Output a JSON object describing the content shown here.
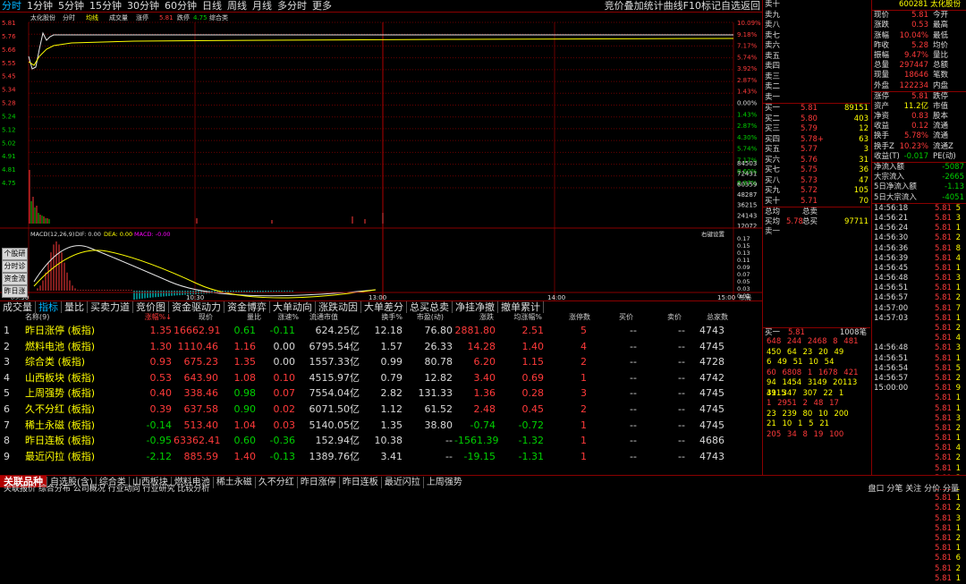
{
  "topbar": {
    "timeframes": [
      "分时",
      "1分钟",
      "5分钟",
      "15分钟",
      "30分钟",
      "60分钟",
      "日线",
      "周线",
      "月线",
      "多分时",
      "更多"
    ],
    "right_text": "竞价叠加统计曲线F10标记自选返回"
  },
  "chart_header": {
    "name": "太化股份",
    "labels": [
      "分时",
      "均线",
      "成交量",
      "涨停"
    ],
    "price_label": "5.81",
    "drop_label": "跌停",
    "drop_value": "4.75",
    "mode": "综合类"
  },
  "price_axis": {
    "left": [
      "5.81",
      "5.76",
      "5.66",
      "5.55",
      "5.45",
      "5.34",
      "5.28",
      "5.24",
      "5.12",
      "5.02",
      "4.91",
      "4.81",
      "4.75"
    ],
    "right": [
      "10.09%",
      "9.18%",
      "7.17%",
      "5.74%",
      "3.92%",
      "2.87%",
      "1.43%",
      "0.00%",
      "1.43%",
      "2.87%",
      "4.30%",
      "5.74%",
      "7.17%",
      "8.60%",
      "9.87%"
    ]
  },
  "volume_axis": [
    "84503",
    "72431",
    "60359",
    "48287",
    "36215",
    "24143",
    "12072"
  ],
  "macd_header": {
    "label": "MACD(12,26,9)",
    "dif": "DIF: 0.00",
    "dea": "DEA: 0.00",
    "macd": "MACD: -0.00",
    "right": "右键设置"
  },
  "macd_axis": [
    "0.17",
    "0.15",
    "0.13",
    "0.11",
    "0.09",
    "0.07",
    "0.05",
    "0.03",
    "0.01"
  ],
  "side_buttons": [
    "个股研报",
    "分时诊断",
    "资金流向",
    "昨日涨停"
  ],
  "time_axis": [
    "09:30",
    "10:30",
    "13:00",
    "14:00",
    "15:00"
  ],
  "time_axis_right": "布局",
  "bottom_tabs": [
    "成交量",
    "指标",
    "量比",
    "买卖力道",
    "竞价图",
    "资金驱动力",
    "资金博弈",
    "大单动向",
    "涨跌动因",
    "大单差分",
    "总买总卖",
    "净挂净撤",
    "撤单累计"
  ],
  "table": {
    "headers": [
      "名称(9)",
      "涨幅%↓",
      "现价",
      "量比",
      "涨速%",
      "流通市值",
      "换手%",
      "市盈(动)",
      "涨跌",
      "均涨幅%",
      "涨停数",
      "买价",
      "卖价",
      "总家数"
    ],
    "rows": [
      {
        "no": "1",
        "name": "昨日涨停",
        "type": "(板指)",
        "chg": "1.35",
        "price": "16662.91",
        "vr": "0.61",
        "spd": "-0.11",
        "cap": "624.25亿",
        "turn": "12.18",
        "pe": "76.80",
        "delta": "2881.80",
        "avg": "2.51",
        "up": "5",
        "bid": "--",
        "ask": "--",
        "total": "4743"
      },
      {
        "no": "2",
        "name": "燃料电池",
        "type": "(板指)",
        "chg": "1.30",
        "price": "1110.46",
        "vr": "1.16",
        "spd": "0.00",
        "cap": "6795.54亿",
        "turn": "1.57",
        "pe": "26.33",
        "delta": "14.28",
        "avg": "1.40",
        "up": "4",
        "bid": "--",
        "ask": "--",
        "total": "4745"
      },
      {
        "no": "3",
        "name": "综合类",
        "type": "(板指)",
        "chg": "0.93",
        "price": "675.23",
        "vr": "1.35",
        "spd": "0.00",
        "cap": "1557.33亿",
        "turn": "0.99",
        "pe": "80.78",
        "delta": "6.20",
        "avg": "1.15",
        "up": "2",
        "bid": "--",
        "ask": "--",
        "total": "4728"
      },
      {
        "no": "4",
        "name": "山西板块",
        "type": "(板指)",
        "chg": "0.53",
        "price": "643.90",
        "vr": "1.08",
        "spd": "0.10",
        "cap": "4515.97亿",
        "turn": "0.79",
        "pe": "12.82",
        "delta": "3.40",
        "avg": "0.69",
        "up": "1",
        "bid": "--",
        "ask": "--",
        "total": "4742"
      },
      {
        "no": "5",
        "name": "上周强势",
        "type": "(板指)",
        "chg": "0.40",
        "price": "338.46",
        "vr": "0.98",
        "spd": "0.07",
        "cap": "7554.04亿",
        "turn": "2.82",
        "pe": "131.33",
        "delta": "1.36",
        "avg": "0.28",
        "up": "3",
        "bid": "--",
        "ask": "--",
        "total": "4745"
      },
      {
        "no": "6",
        "name": "久不分红",
        "type": "(板指)",
        "chg": "0.39",
        "price": "637.58",
        "vr": "0.90",
        "spd": "0.02",
        "cap": "6071.50亿",
        "turn": "1.12",
        "pe": "61.52",
        "delta": "2.48",
        "avg": "0.45",
        "up": "2",
        "bid": "--",
        "ask": "--",
        "total": "4745"
      },
      {
        "no": "7",
        "name": "稀土永磁",
        "type": "(板指)",
        "chg": "-0.14",
        "price": "513.40",
        "vr": "1.04",
        "spd": "0.03",
        "cap": "5140.05亿",
        "turn": "1.35",
        "pe": "38.80",
        "delta": "-0.74",
        "avg": "-0.72",
        "up": "1",
        "bid": "--",
        "ask": "--",
        "total": "4745"
      },
      {
        "no": "8",
        "name": "昨日连板",
        "type": "(板指)",
        "chg": "-0.95",
        "price": "63362.41",
        "vr": "0.60",
        "spd": "-0.36",
        "cap": "152.94亿",
        "turn": "10.38",
        "pe": "--",
        "delta": "-1561.39",
        "avg": "-1.32",
        "up": "1",
        "bid": "--",
        "ask": "--",
        "total": "4686"
      },
      {
        "no": "9",
        "name": "最近闪拉",
        "type": "(板指)",
        "chg": "-2.12",
        "price": "885.59",
        "vr": "1.40",
        "spd": "-0.13",
        "cap": "1389.76亿",
        "turn": "3.41",
        "pe": "--",
        "delta": "-19.15",
        "avg": "-1.31",
        "up": "1",
        "bid": "--",
        "ask": "--",
        "total": "4743"
      }
    ]
  },
  "bottom": {
    "label": "关联品种",
    "tabs": [
      "自选股(含)",
      "综合类",
      "山西板块",
      "燃料电池",
      "稀土永磁",
      "久不分红",
      "昨日涨停",
      "昨日连板",
      "最近闪拉",
      "上周强势"
    ],
    "sub": "关联报价 综合分布 公司概况 行业动向 行业研究 比较分析",
    "right": "盘口  分笔  关注  分价  分量"
  },
  "orderbook": {
    "sells": [
      [
        "卖十",
        "",
        ""
      ],
      [
        "卖九",
        "",
        ""
      ],
      [
        "卖八",
        "",
        ""
      ],
      [
        "卖七",
        "",
        ""
      ],
      [
        "卖六",
        "",
        ""
      ],
      [
        "卖五",
        "",
        ""
      ],
      [
        "卖四",
        "",
        ""
      ],
      [
        "卖三",
        "",
        ""
      ],
      [
        "卖二",
        "",
        ""
      ],
      [
        "卖一",
        "",
        ""
      ]
    ],
    "buys": [
      [
        "买一",
        "5.81",
        "89151"
      ],
      [
        "买二",
        "5.80",
        "403"
      ],
      [
        "买三",
        "5.79",
        "12"
      ],
      [
        "买四",
        "5.78+",
        "63"
      ],
      [
        "买五",
        "5.77",
        "3"
      ],
      [
        "买六",
        "5.76",
        "31"
      ],
      [
        "买七",
        "5.75",
        "36"
      ],
      [
        "买八",
        "5.73",
        "47"
      ],
      [
        "买九",
        "5.72",
        "105"
      ],
      [
        "买十",
        "5.71",
        "70"
      ]
    ],
    "sum_sell": [
      "总均",
      "",
      "总卖",
      ""
    ],
    "sum_buy": [
      "买均",
      "5.78",
      "总买",
      "97711"
    ],
    "extra": "卖一",
    "queue_head": [
      "买一",
      "5.81",
      "1008笔"
    ],
    "queue": [
      "648 244 2468 8 481",
      "450 64 23 20 49",
      "6 49 51 10 54",
      "60 6808 1 1678 421",
      "94 1454 3149 20113 3115",
      "49 347 307 22 1",
      "1 2951 2 48 17",
      "23 239 80 10 200",
      "21 10 1 5 21",
      "205 34 8 19 100"
    ]
  },
  "fin": {
    "code": "600281 太化股份",
    "rows": [
      [
        "现价",
        "5.81",
        "今开",
        ""
      ],
      [
        "涨跌",
        "0.53",
        "最高",
        ""
      ],
      [
        "涨幅",
        "10.04%",
        "最低",
        ""
      ],
      [
        "昨收",
        "5.28",
        "均价",
        ""
      ],
      [
        "振幅",
        "9.47%",
        "量比",
        ""
      ],
      [
        "总量",
        "297447",
        "总额",
        ""
      ],
      [
        "现量",
        "18646",
        "笔数",
        ""
      ],
      [
        "外盘",
        "122234",
        "内盘",
        ""
      ]
    ],
    "rows2": [
      [
        "涨停",
        "5.81",
        "跌停",
        ""
      ],
      [
        "资产",
        "11.2亿",
        "市值",
        ""
      ],
      [
        "净资",
        "0.83",
        "股本",
        ""
      ],
      [
        "收益",
        "0.12",
        "流通",
        ""
      ],
      [
        "换手",
        "5.78%",
        "流通",
        ""
      ],
      [
        "换手Z",
        "10.23%",
        "流通Z",
        ""
      ],
      [
        "收益(T)",
        "-0.017",
        "PE(动)",
        ""
      ]
    ],
    "flow": [
      [
        "净流入额",
        "-5087"
      ],
      [
        "大宗流入",
        "-2665"
      ],
      [
        "5日净流入额",
        "-1.13"
      ],
      [
        "5日大宗流入",
        "-4051"
      ]
    ],
    "ticks": [
      [
        "14:56:18",
        "5.81",
        "5"
      ],
      [
        "14:56:21",
        "5.81",
        "3"
      ],
      [
        "14:56:24",
        "5.81",
        "1"
      ],
      [
        "14:56:30",
        "5.81",
        "2"
      ],
      [
        "14:56:36",
        "5.81",
        "8"
      ],
      [
        "14:56:39",
        "5.81",
        "4"
      ],
      [
        "14:56:45",
        "5.81",
        "1"
      ],
      [
        "14:56:48",
        "5.81",
        "3"
      ],
      [
        "14:56:51",
        "5.81",
        "1"
      ],
      [
        "14:56:57",
        "5.81",
        "2"
      ],
      [
        "14:57:00",
        "5.81",
        "7"
      ],
      [
        "14:57:03",
        "5.81",
        "1"
      ],
      [
        "",
        "5.81",
        "2"
      ],
      [
        "",
        "5.81",
        "4"
      ],
      [
        "14:56:48",
        "5.81",
        "3"
      ],
      [
        "14:56:51",
        "5.81",
        "1"
      ],
      [
        "14:56:54",
        "5.81",
        "5"
      ],
      [
        "14:56:57",
        "5.81",
        "2"
      ],
      [
        "15:00:00",
        "5.81",
        "9"
      ],
      [
        "",
        "5.81",
        "1"
      ],
      [
        "",
        "5.81",
        "1"
      ],
      [
        "",
        "5.81",
        "3"
      ],
      [
        "",
        "5.81",
        "2"
      ],
      [
        "",
        "5.81",
        "1"
      ],
      [
        "",
        "5.81",
        "4"
      ],
      [
        "",
        "5.81",
        "2"
      ],
      [
        "",
        "5.81",
        "1"
      ],
      [
        "",
        "5.81",
        "3"
      ],
      [
        "",
        "5.81",
        "5"
      ],
      [
        "",
        "5.81",
        "1"
      ],
      [
        "",
        "5.81",
        "2"
      ],
      [
        "",
        "5.81",
        "3"
      ],
      [
        "",
        "5.81",
        "1"
      ],
      [
        "",
        "5.81",
        "2"
      ],
      [
        "",
        "5.81",
        "1"
      ],
      [
        "",
        "5.81",
        "6"
      ],
      [
        "",
        "5.81",
        "2"
      ],
      [
        "",
        "5.81",
        "1"
      ]
    ]
  }
}
